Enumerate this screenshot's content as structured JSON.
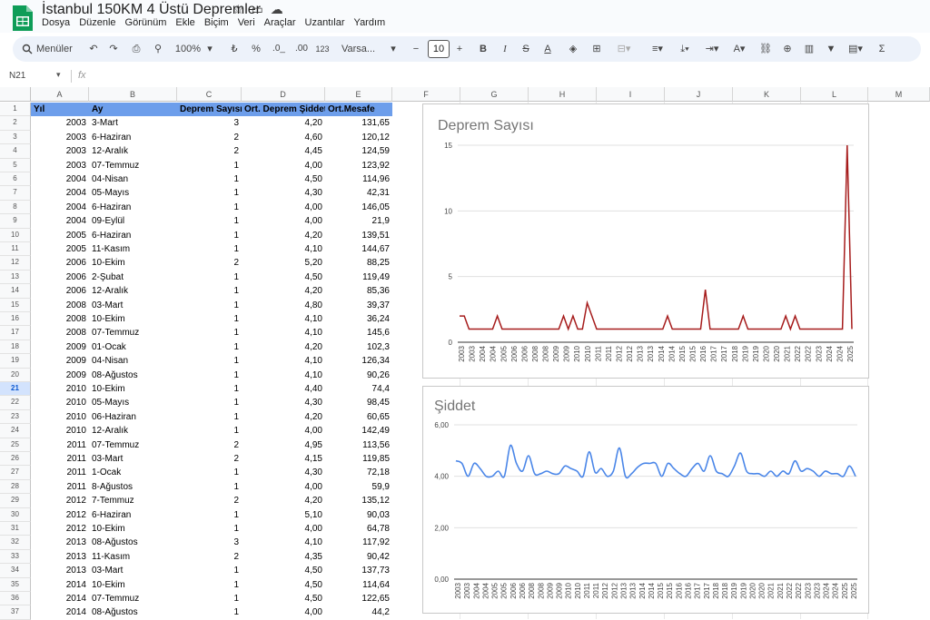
{
  "app": {
    "title": "İstanbul 150KM 4 Üstü Depremler",
    "menu": [
      "Dosya",
      "Düzenle",
      "Görünüm",
      "Ekle",
      "Biçim",
      "Veri",
      "Araçlar",
      "Uzantılar",
      "Yardım"
    ]
  },
  "toolbar": {
    "menus_label": "Menüler",
    "zoom": "100%",
    "currency": "₺",
    "percent": "%",
    "dec_decrease": ".0_",
    "dec_increase": ".00",
    "num_format": "123",
    "font": "Varsa...",
    "font_size": "10"
  },
  "formula_bar": {
    "cell_ref": "N21",
    "fx": "fx",
    "value": ""
  },
  "columns": [
    "A",
    "B",
    "C",
    "D",
    "E",
    "F",
    "G",
    "H",
    "I",
    "J",
    "K",
    "L",
    "M"
  ],
  "selected_row": 21,
  "sheet": {
    "headers": [
      "Yıl",
      "Ay",
      "Deprem Sayısı",
      "Ort. Deprem Şiddeti",
      "Ort.Mesafe"
    ],
    "rows": [
      [
        "2003",
        "3-Mart",
        "3",
        "4,20",
        "131,65"
      ],
      [
        "2003",
        "6-Haziran",
        "2",
        "4,60",
        "120,12"
      ],
      [
        "2003",
        "12-Aralık",
        "2",
        "4,45",
        "124,59"
      ],
      [
        "2003",
        "07-Temmuz",
        "1",
        "4,00",
        "123,92"
      ],
      [
        "2004",
        "04-Nisan",
        "1",
        "4,50",
        "114,96"
      ],
      [
        "2004",
        "05-Mayıs",
        "1",
        "4,30",
        "42,31"
      ],
      [
        "2004",
        "6-Haziran",
        "1",
        "4,00",
        "146,05"
      ],
      [
        "2004",
        "09-Eylül",
        "1",
        "4,00",
        "21,9"
      ],
      [
        "2005",
        "6-Haziran",
        "1",
        "4,20",
        "139,51"
      ],
      [
        "2005",
        "11-Kasım",
        "1",
        "4,10",
        "144,67"
      ],
      [
        "2006",
        "10-Ekim",
        "2",
        "5,20",
        "88,25"
      ],
      [
        "2006",
        "2-Şubat",
        "1",
        "4,50",
        "119,49"
      ],
      [
        "2006",
        "12-Aralık",
        "1",
        "4,20",
        "85,36"
      ],
      [
        "2008",
        "03-Mart",
        "1",
        "4,80",
        "39,37"
      ],
      [
        "2008",
        "10-Ekim",
        "1",
        "4,10",
        "36,24"
      ],
      [
        "2008",
        "07-Temmuz",
        "1",
        "4,10",
        "145,6"
      ],
      [
        "2009",
        "01-Ocak",
        "1",
        "4,20",
        "102,3"
      ],
      [
        "2009",
        "04-Nisan",
        "1",
        "4,10",
        "126,34"
      ],
      [
        "2009",
        "08-Ağustos",
        "1",
        "4,10",
        "90,26"
      ],
      [
        "2010",
        "10-Ekim",
        "1",
        "4,40",
        "74,4"
      ],
      [
        "2010",
        "05-Mayıs",
        "1",
        "4,30",
        "98,45"
      ],
      [
        "2010",
        "06-Haziran",
        "1",
        "4,20",
        "60,65"
      ],
      [
        "2010",
        "12-Aralık",
        "1",
        "4,00",
        "142,49"
      ],
      [
        "2011",
        "07-Temmuz",
        "2",
        "4,95",
        "113,56"
      ],
      [
        "2011",
        "03-Mart",
        "2",
        "4,15",
        "119,85"
      ],
      [
        "2011",
        "1-Ocak",
        "1",
        "4,30",
        "72,18"
      ],
      [
        "2011",
        "8-Ağustos",
        "1",
        "4,00",
        "59,9"
      ],
      [
        "2012",
        "7-Temmuz",
        "2",
        "4,20",
        "135,12"
      ],
      [
        "2012",
        "6-Haziran",
        "1",
        "5,10",
        "90,03"
      ],
      [
        "2012",
        "10-Ekim",
        "1",
        "4,00",
        "64,78"
      ],
      [
        "2013",
        "08-Ağustos",
        "3",
        "4,10",
        "117,92"
      ],
      [
        "2013",
        "11-Kasım",
        "2",
        "4,35",
        "90,42"
      ],
      [
        "2013",
        "03-Mart",
        "1",
        "4,50",
        "137,73"
      ],
      [
        "2014",
        "10-Ekim",
        "1",
        "4,50",
        "114,64"
      ],
      [
        "2014",
        "07-Temmuz",
        "1",
        "4,50",
        "122,65"
      ],
      [
        "2014",
        "08-Ağustos",
        "1",
        "4,00",
        "44,2"
      ]
    ]
  },
  "chart_data": [
    {
      "type": "line",
      "title": "Deprem Sayısı",
      "color": "#a61c1c",
      "ylim": [
        0,
        15
      ],
      "yticks": [
        "0",
        "5",
        "10",
        "15"
      ],
      "xticks": [
        "2003",
        "2003",
        "2004",
        "2004",
        "2005",
        "2006",
        "2006",
        "2008",
        "2008",
        "2009",
        "2009",
        "2010",
        "2010",
        "2011",
        "2011",
        "2012",
        "2012",
        "2013",
        "2013",
        "2014",
        "2014",
        "2015",
        "2015",
        "2016",
        "2017",
        "2017",
        "2018",
        "2019",
        "2019",
        "2020",
        "2020",
        "2021",
        "2022",
        "2022",
        "2023",
        "2024",
        "2024",
        "2025"
      ],
      "values": [
        2,
        2,
        1,
        1,
        1,
        1,
        1,
        1,
        2,
        1,
        1,
        1,
        1,
        1,
        1,
        1,
        1,
        1,
        1,
        1,
        1,
        1,
        2,
        1,
        2,
        1,
        1,
        3,
        2,
        1,
        1,
        1,
        1,
        1,
        1,
        1,
        1,
        1,
        1,
        1,
        1,
        1,
        1,
        1,
        2,
        1,
        1,
        1,
        1,
        1,
        1,
        1,
        4,
        1,
        1,
        1,
        1,
        1,
        1,
        1,
        2,
        1,
        1,
        1,
        1,
        1,
        1,
        1,
        1,
        2,
        1,
        2,
        1,
        1,
        1,
        1,
        1,
        1,
        1,
        1,
        1,
        1,
        15,
        1
      ],
      "grid": true,
      "legend": "none"
    },
    {
      "type": "line",
      "title": "Şiddet",
      "color": "#4a86e8",
      "ylim": [
        0,
        6
      ],
      "yticks": [
        "0,00",
        "2,00",
        "4,00",
        "6,00"
      ],
      "xticks": [
        "2003",
        "2003",
        "2004",
        "2004",
        "2005",
        "2005",
        "2006",
        "2006",
        "2008",
        "2008",
        "2009",
        "2009",
        "2010",
        "2010",
        "2011",
        "2011",
        "2012",
        "2012",
        "2013",
        "2013",
        "2014",
        "2014",
        "2015",
        "2015",
        "2016",
        "2016",
        "2017",
        "2017",
        "2018",
        "2018",
        "2019",
        "2019",
        "2020",
        "2020",
        "2021",
        "2021",
        "2022",
        "2022",
        "2023",
        "2023",
        "2024",
        "2024",
        "2025",
        "2025"
      ],
      "values": [
        4.6,
        4.5,
        4.0,
        4.5,
        4.3,
        4.0,
        4.0,
        4.2,
        4.0,
        5.2,
        4.5,
        4.2,
        4.8,
        4.1,
        4.1,
        4.2,
        4.1,
        4.1,
        4.4,
        4.3,
        4.2,
        4.0,
        4.95,
        4.15,
        4.3,
        4.0,
        4.2,
        5.1,
        4.0,
        4.1,
        4.35,
        4.5,
        4.5,
        4.5,
        4.0,
        4.5,
        4.3,
        4.1,
        4.0,
        4.3,
        4.5,
        4.2,
        4.8,
        4.2,
        4.1,
        4.0,
        4.4,
        4.9,
        4.2,
        4.1,
        4.1,
        4.0,
        4.2,
        4.0,
        4.2,
        4.1,
        4.6,
        4.2,
        4.3,
        4.2,
        4.0,
        4.2,
        4.1,
        4.1,
        4.0,
        4.4,
        4.0
      ],
      "grid": true,
      "legend": "none"
    }
  ]
}
